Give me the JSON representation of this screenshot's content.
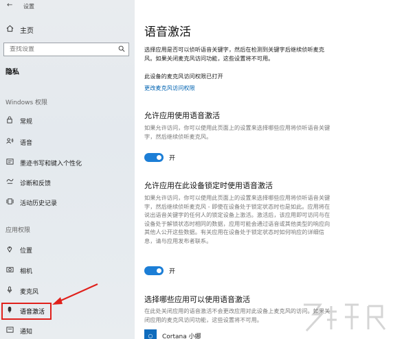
{
  "window": {
    "title": "设置"
  },
  "sidebar": {
    "home_label": "主页",
    "search_placeholder": "查找设置",
    "current_section": "隐私",
    "group_windows": "Windows 权限",
    "windows_items": [
      {
        "label": "常规",
        "icon": "lock-icon"
      },
      {
        "label": "语音",
        "icon": "speech-icon"
      },
      {
        "label": "墨迹书写和键入个性化",
        "icon": "inking-icon"
      },
      {
        "label": "诊断和反馈",
        "icon": "diagnostics-icon"
      },
      {
        "label": "活动历史记录",
        "icon": "activity-history-icon"
      }
    ],
    "group_app": "应用权限",
    "app_items": [
      {
        "label": "位置",
        "icon": "location-icon"
      },
      {
        "label": "相机",
        "icon": "camera-icon"
      },
      {
        "label": "麦克风",
        "icon": "microphone-icon"
      },
      {
        "label": "语音激活",
        "icon": "voice-activation-icon",
        "active": true
      },
      {
        "label": "通知",
        "icon": "notification-icon"
      }
    ]
  },
  "main": {
    "title": "语音激活",
    "intro": "选择应用是否可以侦听语音关键字，然后在检测到关键字后继续侦听麦克风。如果关闭麦克风访问功能，这些设置将不可用。",
    "status": "此设备的麦克风访问权限已打开",
    "change_link": "更改麦克风访问权限",
    "section1": {
      "title": "允许应用使用语音激活",
      "desc": "如果允许访问，你可以使用此页面上的设置来选择哪些应用将侦听语音关键字，然后继续侦听麦克风。",
      "toggle_state": "开"
    },
    "section2": {
      "title": "允许应用在此设备锁定时使用语音激活",
      "desc": "如果允许访问，你可以使用此页面上的设置来选择哪些应用将侦听语音关键字，然后继续侦听麦克风 - 即使在设备处于锁定状态时也是如此。应用将在说出语音关键字的任何人的锁定设备上激活。激活后，该应用即可访问与在设备处于解锁状态时相同的数据，应用可能会通过语音或其他类型的响应向其他人公开这些数据。有关应用在设备处于锁定状态时如何响应的详细信息，请与应用发布者联系。",
      "toggle_state": "开"
    },
    "section3": {
      "title": "选择哪些应用可以使用语音激活",
      "desc": "在此处关闭应用的语音激活不会更改应用对此设备上麦克风的访问。如果关闭应用的麦克风访问功能，这些设置将不可用。"
    },
    "bottom_app": "Cortana 小娜"
  },
  "colors": {
    "accent": "#1c7ed6",
    "link": "#0063b1",
    "highlight": "#e0201b"
  }
}
